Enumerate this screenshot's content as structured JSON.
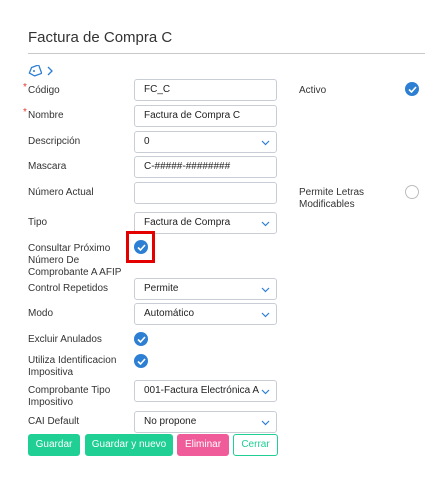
{
  "page": {
    "title": "Factura de Compra C"
  },
  "fields": {
    "codigo": {
      "label": "Código",
      "value": "FC_C"
    },
    "nombre": {
      "label": "Nombre",
      "value": "Factura de Compra C"
    },
    "descripcion": {
      "label": "Descripción",
      "value": "0"
    },
    "mascara": {
      "label": "Mascara",
      "value": "C-#####-########"
    },
    "numero_actual": {
      "label": "Número Actual",
      "value": ""
    },
    "tipo": {
      "label": "Tipo",
      "value": "Factura de Compra"
    },
    "consultar_afip": {
      "label_lines": [
        "Consultar Próximo",
        "Número De",
        "Comprobante A AFIP"
      ],
      "checked": true
    },
    "control_repetidos": {
      "label": "Control Repetidos",
      "value": "Permite"
    },
    "modo": {
      "label": "Modo",
      "value": "Automático"
    },
    "excluir_anulados": {
      "label": "Excluir Anulados",
      "checked": true
    },
    "identificacion_impositiva": {
      "label_lines": [
        "Utiliza Identificacion",
        "Impositiva"
      ],
      "checked": true
    },
    "comprobante_tipo_impositivo": {
      "label_lines": [
        "Comprobante Tipo",
        "Impositivo"
      ],
      "value": "001-Factura Electrónica A"
    },
    "cai_default": {
      "label": "CAI Default",
      "value": "No propone"
    },
    "activo": {
      "label": "Activo",
      "checked": true
    },
    "permite_letras": {
      "label_lines": [
        "Permite Letras",
        "Modificables"
      ],
      "checked": false
    }
  },
  "buttons": {
    "save": "Guardar",
    "save_new": "Guardar y nuevo",
    "delete": "Eliminar",
    "close": "Cerrar"
  },
  "colors": {
    "accent_green": "#1fcf93",
    "delete_pink": "#f05b99",
    "check_blue": "#2d7fd3",
    "highlight_red": "#e50000"
  }
}
